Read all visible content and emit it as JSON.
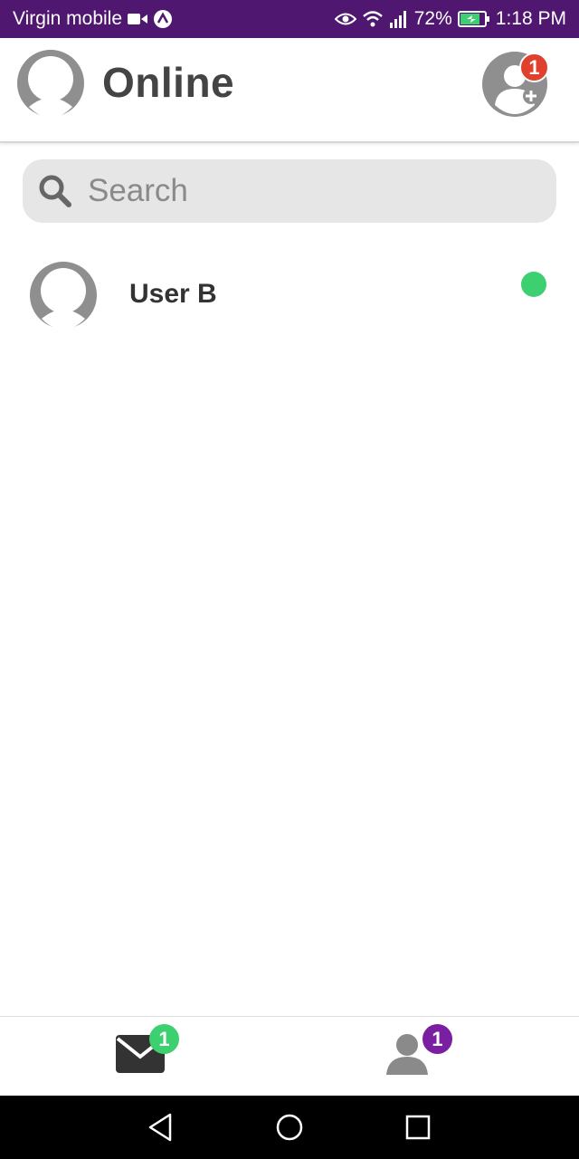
{
  "status_bar": {
    "carrier": "Virgin mobile",
    "battery": "72%",
    "time": "1:18 PM",
    "icons": [
      "video-call-icon",
      "app-notification-icon",
      "eye-icon",
      "wifi-icon",
      "signal-icon",
      "battery-charging-icon"
    ]
  },
  "header": {
    "title": "Online",
    "friend_requests_badge": "1"
  },
  "search": {
    "placeholder": "Search",
    "value": ""
  },
  "users": [
    {
      "name": "User B",
      "status": "online"
    }
  ],
  "tab_bar": {
    "messages_badge": "1",
    "contacts_badge": "1"
  },
  "colors": {
    "status_bar": "#4f1770",
    "online": "#3cd070",
    "request_badge": "#e0402c",
    "contacts_badge": "#7a1fa2",
    "search_bg": "#e6e6e6"
  }
}
